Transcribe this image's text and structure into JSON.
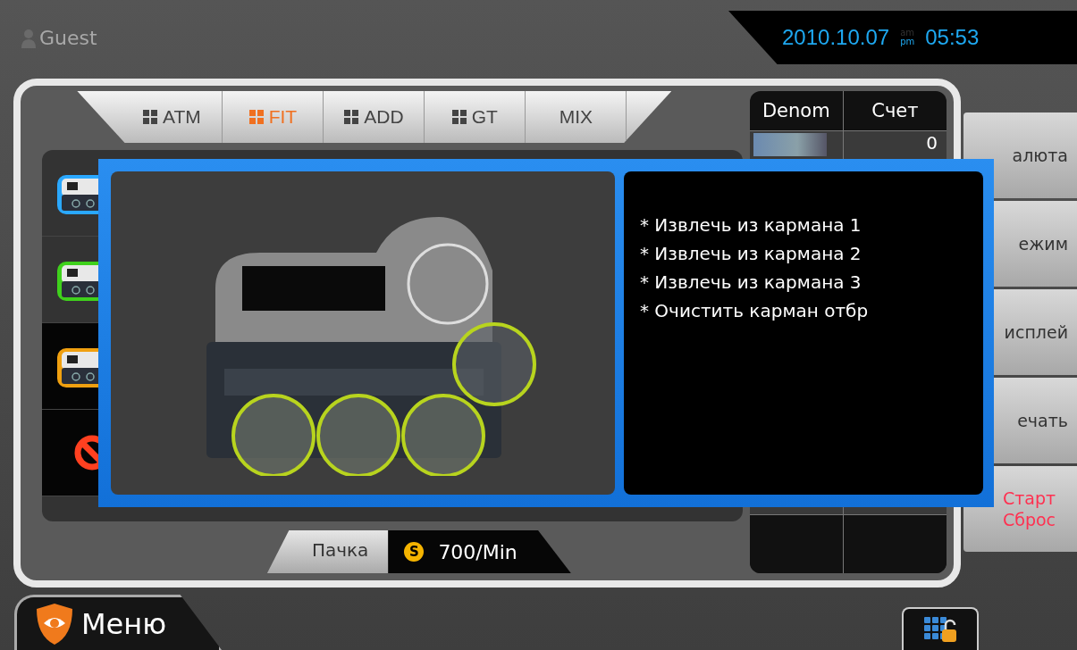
{
  "user": {
    "name": "Guest"
  },
  "clock": {
    "date": "2010.10.07",
    "meridiem": [
      {
        "label": "am",
        "selected": false
      },
      {
        "label": "pm",
        "selected": true
      }
    ],
    "time": "05:53"
  },
  "tabs": [
    {
      "label": "ATM",
      "icon": true,
      "selected": false
    },
    {
      "label": "FIT",
      "icon": true,
      "selected": true
    },
    {
      "label": "ADD",
      "icon": true,
      "selected": false
    },
    {
      "label": "GT",
      "icon": true,
      "selected": false
    },
    {
      "label": "MIX",
      "icon": false,
      "selected": false
    }
  ],
  "sidebar": {
    "items": [
      {
        "kind": "machine",
        "color": "#2aa8ff",
        "selected": false
      },
      {
        "kind": "machine",
        "color": "#3fd11c",
        "selected": false
      },
      {
        "kind": "machine",
        "color": "#f0a010",
        "selected": true
      },
      {
        "kind": "prohibited",
        "color": "#ff4020",
        "selected": true
      }
    ]
  },
  "table": {
    "columns": [
      "Denom",
      "Счет"
    ],
    "rows": [
      {
        "count": "0"
      }
    ]
  },
  "side_buttons": [
    {
      "label": "алюта",
      "kind": "normal"
    },
    {
      "label": "ежим",
      "kind": "normal"
    },
    {
      "label": "исплей",
      "kind": "normal"
    },
    {
      "label": "ечать",
      "kind": "normal"
    },
    {
      "label": "Старт\nСброс",
      "kind": "alert"
    }
  ],
  "speed": {
    "mode": "Пачка",
    "badge": "S",
    "rate": "700/Min"
  },
  "menu": {
    "label": "Меню"
  },
  "dialog": {
    "messages": [
      "* Извлечь из кармана 1",
      "* Извлечь из кармана 2",
      "* Извлечь из кармана 3",
      "* Очистить карман отбр"
    ]
  }
}
